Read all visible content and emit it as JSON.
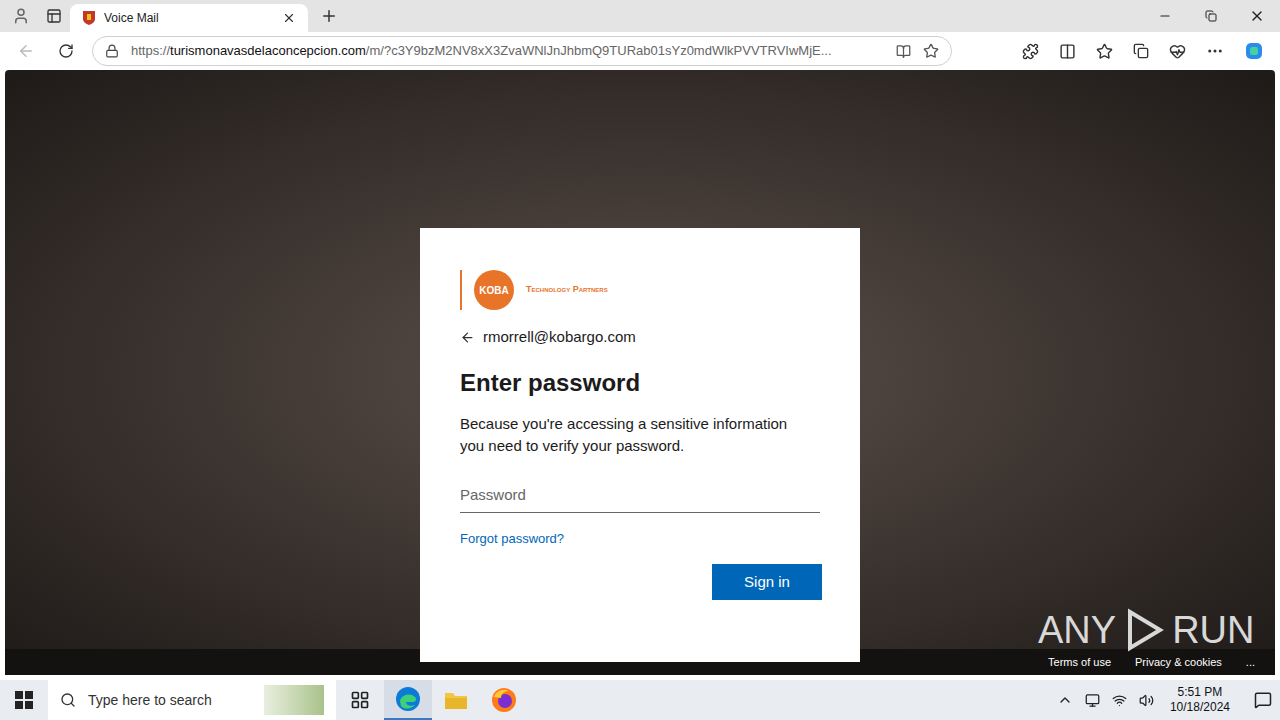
{
  "browser": {
    "tabs": [
      {
        "title": "Voice Mail",
        "selected": true
      }
    ],
    "back_disabled": true,
    "url": {
      "scheme": "https://",
      "domain": "turismonavasdelaconcepcion.com",
      "path": "/m/?c3Y9bzM2NV8xX3ZvaWNlJnJhbmQ9TURab01sYz0mdWlkPVVTRVIwMjE..."
    }
  },
  "dialog": {
    "logo": "KOBA",
    "tagline": "Technology Partners",
    "email": "rmorrell@kobargo.com",
    "title": "Enter password",
    "message": "Because you're accessing a sensitive information you need to verify your password.",
    "password_placeholder": "Password",
    "forgot_link": "Forgot password?",
    "button": "Sign in"
  },
  "footer": {
    "links": [
      "Terms of use",
      "Privacy & cookies",
      "..."
    ]
  },
  "watermark": {
    "left": "ANY",
    "right": "RUN"
  },
  "taskbar": {
    "search_placeholder": "Type here to search",
    "apps": [
      {
        "kind": "taskview",
        "selected": false
      },
      {
        "kind": "edge",
        "selected": true
      },
      {
        "kind": "explorer",
        "selected": false
      },
      {
        "kind": "firefox",
        "selected": false
      }
    ],
    "time": "5:51 PM",
    "date": "10/18/2024"
  }
}
